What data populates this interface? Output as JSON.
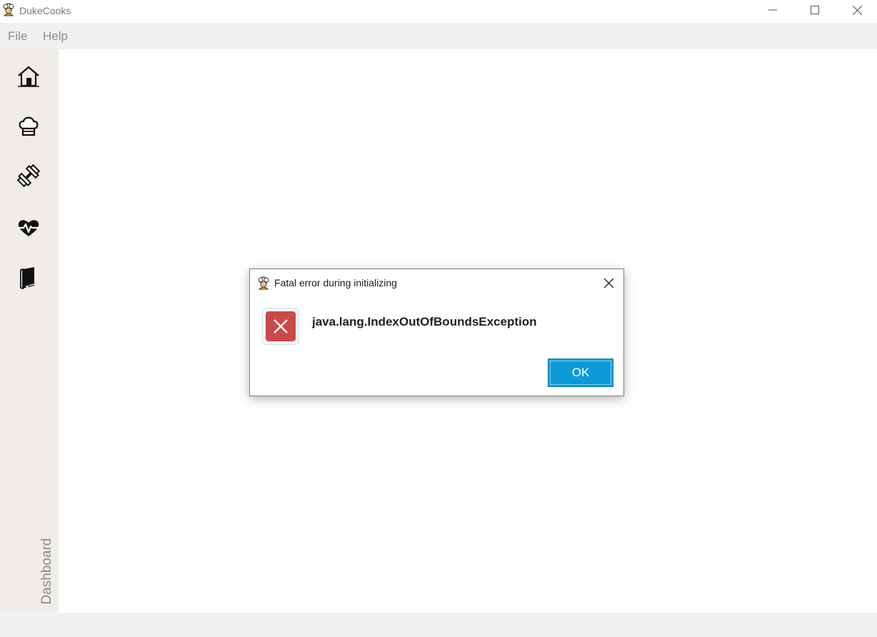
{
  "window": {
    "title": "DukeCooks",
    "icon": "chef-icon"
  },
  "menu": {
    "items": [
      {
        "label": "File"
      },
      {
        "label": "Help"
      }
    ]
  },
  "sidebar": {
    "buttons": [
      {
        "icon": "home-icon"
      },
      {
        "icon": "chef-hat-icon"
      },
      {
        "icon": "dumbbell-icon"
      },
      {
        "icon": "heartbeat-icon"
      },
      {
        "icon": "book-icon"
      }
    ],
    "current_page_label": "Dashboard"
  },
  "dialog": {
    "title": "Fatal error during initializing",
    "message": "java.lang.IndexOutOfBoundsException",
    "ok_label": "OK",
    "error_color": "#c94a4a",
    "button_color": "#0d9ad6"
  }
}
